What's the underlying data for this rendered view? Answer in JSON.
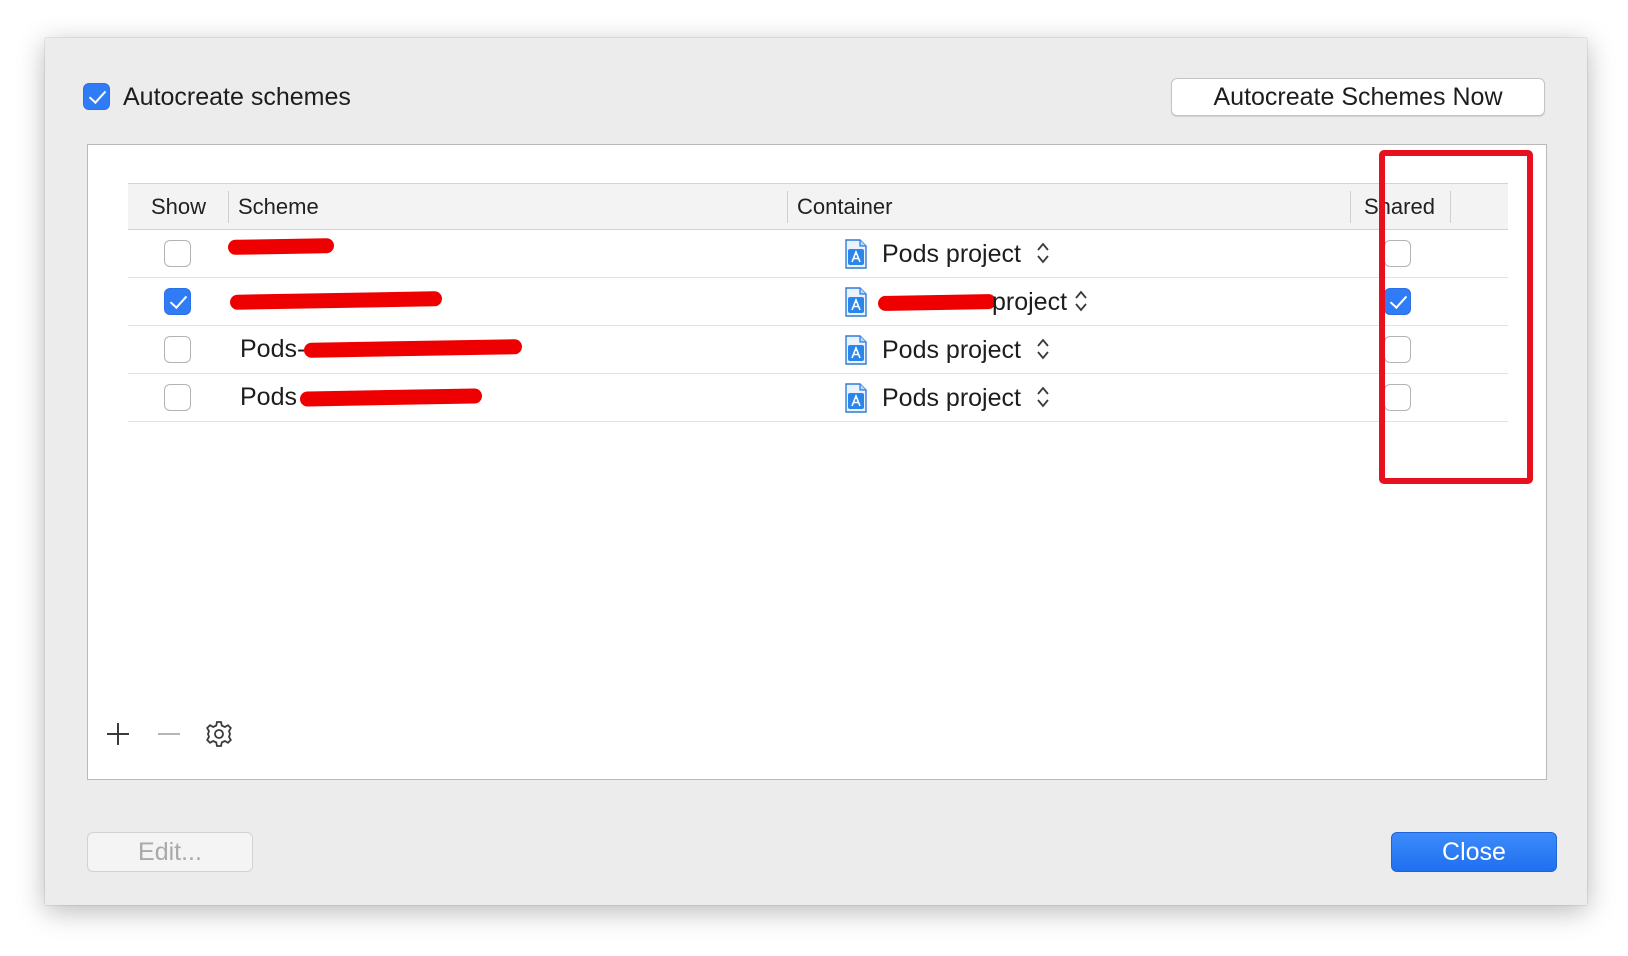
{
  "header": {
    "autocreate_label": "Autocreate schemes",
    "autocreate_checked": true,
    "autocreate_now_button": "Autocreate Schemes Now"
  },
  "table": {
    "columns": [
      "Show",
      "Scheme",
      "Container",
      "Shared"
    ],
    "rows": [
      {
        "show": false,
        "scheme": "",
        "container": "Pods project",
        "shared": false
      },
      {
        "show": true,
        "scheme": "",
        "container": "project",
        "shared": true
      },
      {
        "show": false,
        "scheme": "Pods-",
        "container": "Pods project",
        "shared": false
      },
      {
        "show": false,
        "scheme": "Pods",
        "container": "Pods project",
        "shared": false
      }
    ]
  },
  "toolbar": {
    "icons": [
      "plus-icon",
      "minus-icon",
      "gear-icon"
    ]
  },
  "footer": {
    "edit_button": "Edit...",
    "close_button": "Close"
  },
  "colors": {
    "accent": "#2f7cf6",
    "annotation": "#e8101f",
    "redaction": "#ee0000"
  }
}
